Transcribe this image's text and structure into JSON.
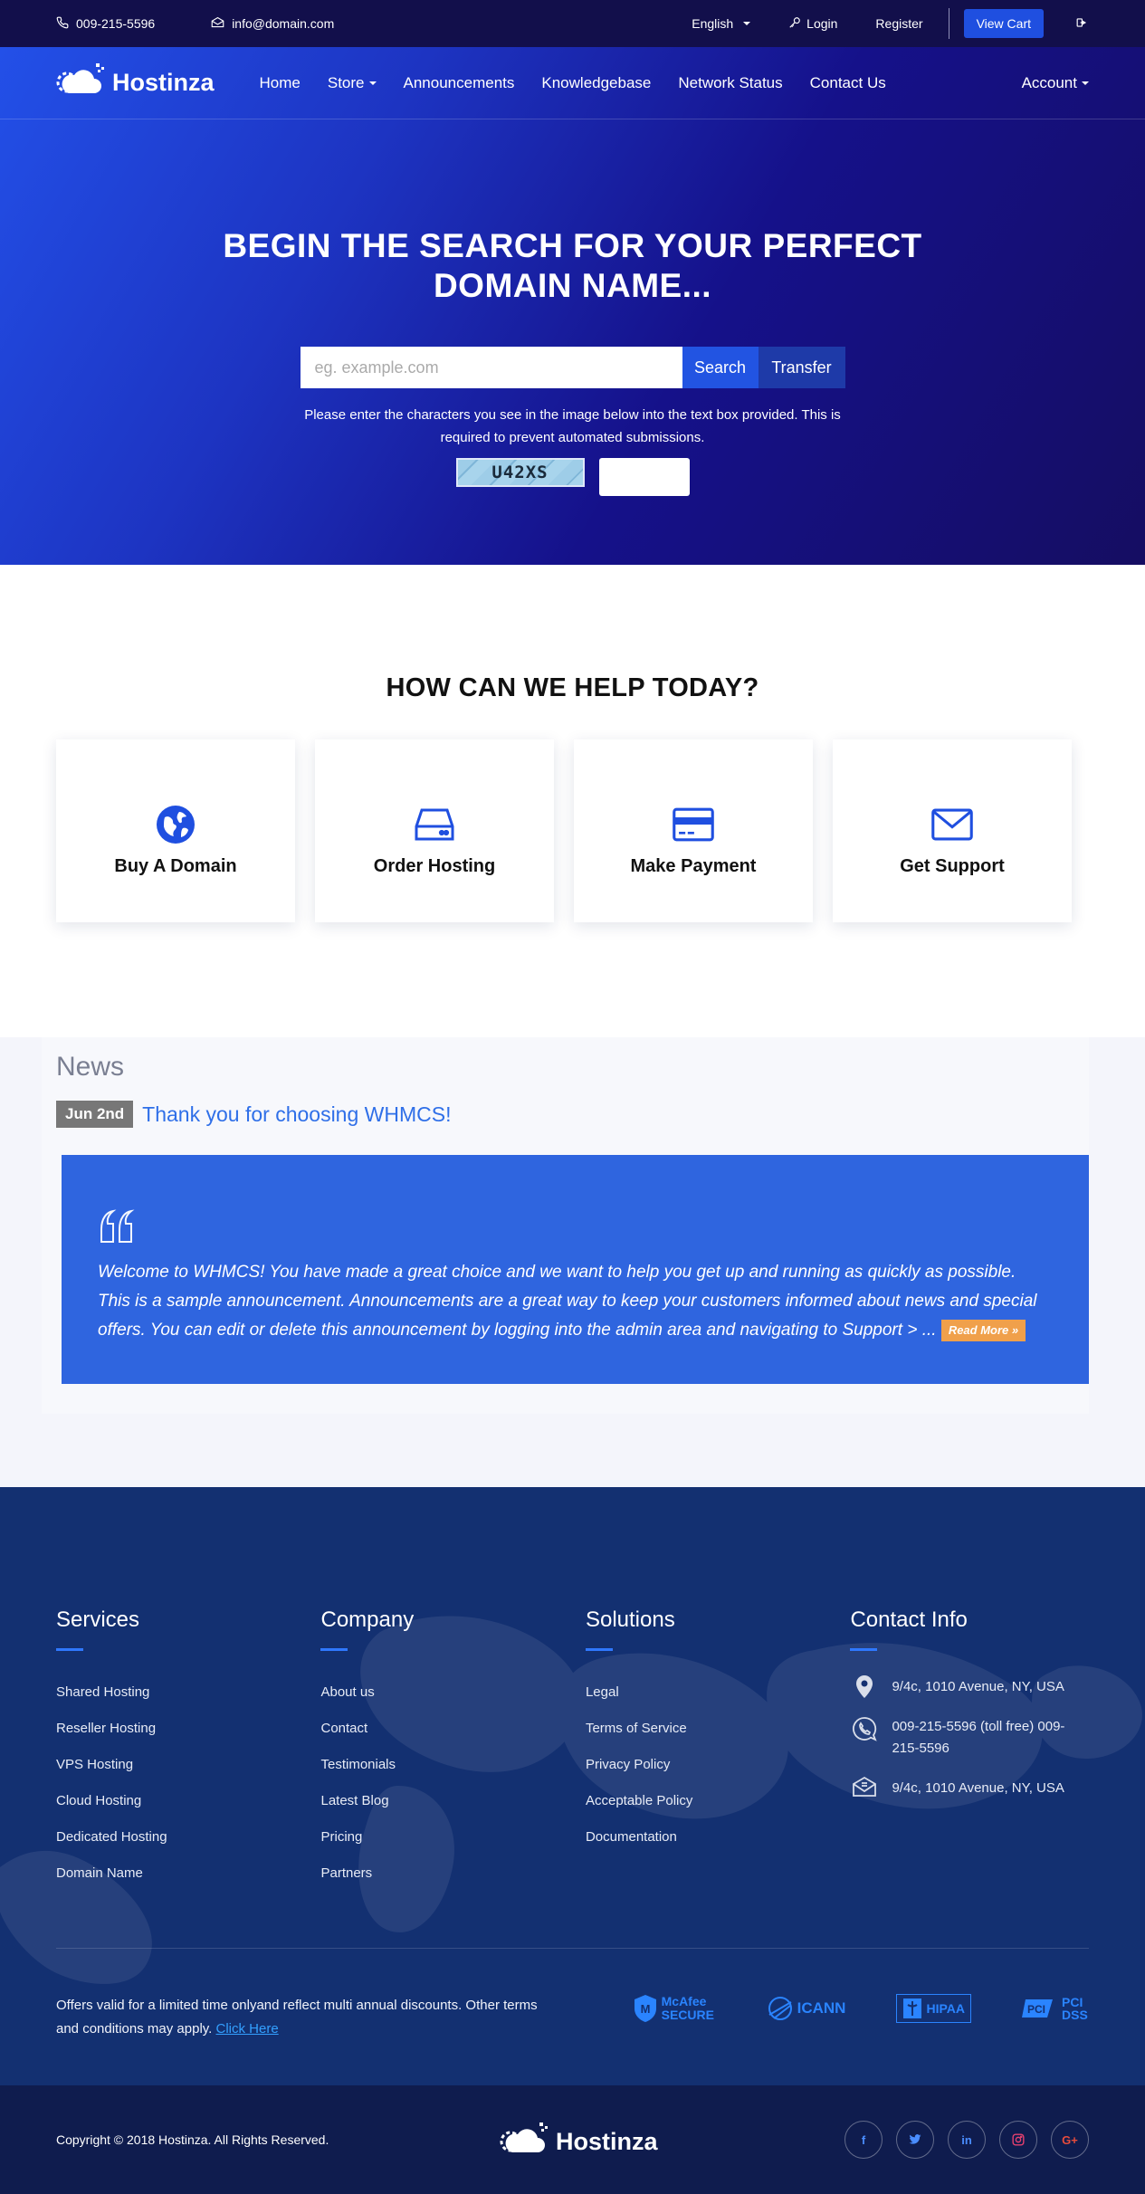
{
  "topbar": {
    "phone": "009-215-5596",
    "email": "info@domain.com",
    "language": "English",
    "login": "Login",
    "register": "Register",
    "view_cart": "View Cart"
  },
  "brand": {
    "name": "Hostinza"
  },
  "nav": {
    "items": [
      "Home",
      "Store",
      "Announcements",
      "Knowledgebase",
      "Network Status",
      "Contact Us"
    ],
    "account": "Account"
  },
  "hero": {
    "title": "BEGIN THE SEARCH FOR YOUR PERFECT DOMAIN NAME...",
    "placeholder": "eg. example.com",
    "search_label": "Search",
    "transfer_label": "Transfer",
    "captcha_instructions": "Please enter the characters you see in the image below into the text box provided. This is required to prevent automated submissions.",
    "captcha_code": "U42XS"
  },
  "help": {
    "title": "HOW CAN WE HELP TODAY?",
    "cards": [
      {
        "label": "Buy A Domain",
        "icon": "globe-icon"
      },
      {
        "label": "Order Hosting",
        "icon": "server-icon"
      },
      {
        "label": "Make Payment",
        "icon": "credit-card-icon"
      },
      {
        "label": "Get Support",
        "icon": "envelope-icon"
      }
    ]
  },
  "news": {
    "heading": "News",
    "date": "Jun 2nd",
    "title": "Thank you for choosing WHMCS!",
    "body": "Welcome to WHMCS! You have made a great choice and we want to help you get up and running as quickly as possible. This is a sample announcement. Announcements are a great way to keep your customers informed about news and special offers. You can edit or delete this announcement by logging into the admin area and navigating to Support > ...",
    "read_more": "Read More »"
  },
  "footer": {
    "services": {
      "title": "Services",
      "links": [
        "Shared Hosting",
        "Reseller Hosting",
        "VPS Hosting",
        "Cloud Hosting",
        "Dedicated Hosting",
        "Domain Name"
      ]
    },
    "company": {
      "title": "Company",
      "links": [
        "About us",
        "Contact",
        "Testimonials",
        "Latest Blog",
        "Pricing",
        "Partners"
      ]
    },
    "solutions": {
      "title": "Solutions",
      "links": [
        "Legal",
        "Terms of Service",
        "Privacy Policy",
        "Acceptable Policy",
        "Documentation"
      ]
    },
    "contact": {
      "title": "Contact Info",
      "address": "9/4c, 1010 Avenue, NY, USA",
      "phone": "009-215-5596 (toll free) 009-215-5596",
      "mail": "9/4c, 1010 Avenue, NY, USA"
    },
    "offer_text": "Offers valid for a limited time onlyand reflect multi annual discounts. Other terms and conditions may apply.",
    "offer_link": "Click Here",
    "badges": [
      "McAfee SECURE",
      "ICANN",
      "HIPAA",
      "PCI DSS"
    ],
    "copyright": "Copyright © 2018 Hostinza. All Rights Reserved.",
    "socials": [
      "f",
      "t",
      "in",
      "ig",
      "G+"
    ]
  },
  "colors": {
    "topbar": "#120f4b",
    "accent": "#1f4fe0",
    "news_box": "#2f65df",
    "footer": "#133071",
    "bottom": "#0f1c4e",
    "read_more": "#f0a04b"
  }
}
